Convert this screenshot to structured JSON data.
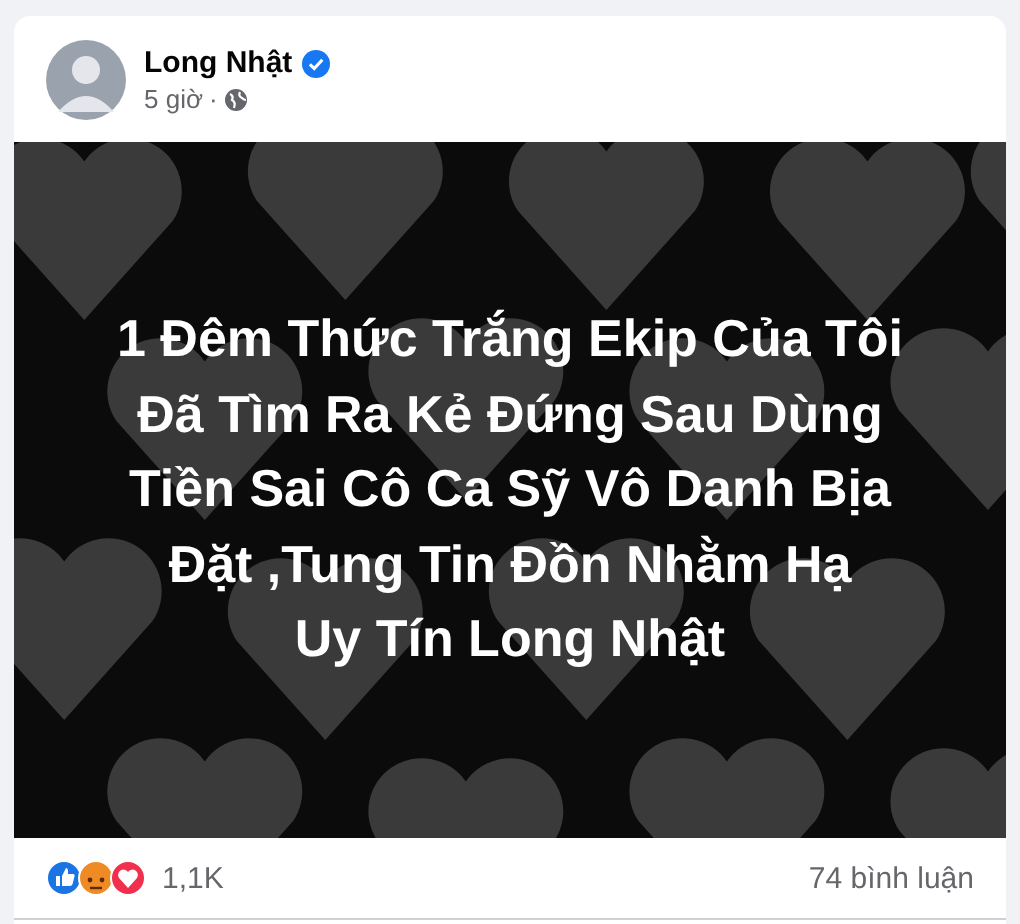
{
  "post": {
    "author": "Long Nhật",
    "verified": true,
    "time": "5 giờ",
    "separator": "·",
    "audience_icon": {
      "kind": "globe"
    }
  },
  "image": {
    "caption_lines": [
      "1 Đêm Thức Trắng Ekip Của Tôi",
      "Đã Tìm Ra Kẻ Đứng Sau Dùng",
      "Tiền Sai Cô Ca Sỹ Vô Danh Bịa",
      "Đặt ,Tung Tin Đồn Nhằm Hạ",
      "Uy Tín Long Nhật"
    ]
  },
  "footer": {
    "reactions": [
      {
        "kind": "like"
      },
      {
        "kind": "angry"
      },
      {
        "kind": "love"
      }
    ],
    "reaction_count": "1,1K",
    "comments": "74 bình luận"
  }
}
